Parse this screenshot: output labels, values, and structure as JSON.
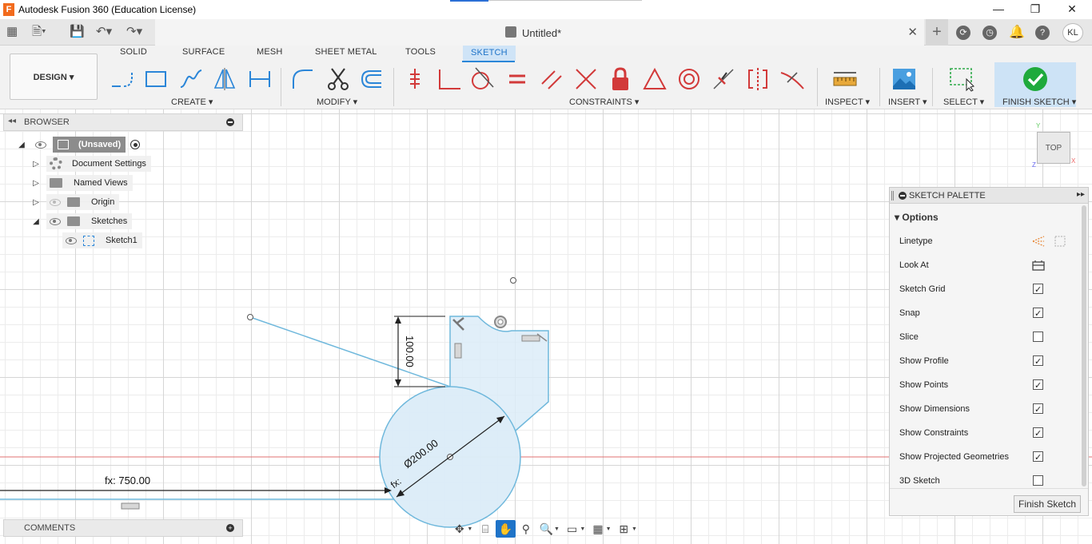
{
  "window": {
    "title": "Autodesk Fusion 360 (Education License)",
    "logo_letter": "F",
    "minimize": "—",
    "maximize": "❐",
    "close": "✕"
  },
  "appbar": {
    "doc_name": "Untitled*",
    "doc_close": "✕",
    "new_tab": "+",
    "user_initials": "KL"
  },
  "ribbon": {
    "tabs": [
      "SOLID",
      "SURFACE",
      "MESH",
      "SHEET METAL",
      "TOOLS",
      "SKETCH"
    ],
    "active_tab": "SKETCH",
    "workspace": "DESIGN ▾",
    "groups": {
      "create": "CREATE ▾",
      "modify": "MODIFY ▾",
      "constraints": "CONSTRAINTS ▾",
      "inspect": "INSPECT ▾",
      "insert": "INSERT ▾",
      "select": "SELECT ▾",
      "finish": "FINISH SKETCH ▾"
    },
    "accent_color": "#2b86d8",
    "finish_color": "#1faa3c",
    "constraint_red": "#d23a3a"
  },
  "browser": {
    "title": "BROWSER",
    "collapse": "◂◂",
    "root": "(Unsaved)",
    "items": [
      {
        "label": "Document Settings"
      },
      {
        "label": "Named Views"
      },
      {
        "label": "Origin"
      },
      {
        "label": "Sketches"
      },
      {
        "label": "Sketch1"
      }
    ]
  },
  "comments": {
    "title": "COMMENTS",
    "add": "+"
  },
  "viewcube": {
    "face": "TOP",
    "axis_x": "X",
    "axis_y": "Y",
    "axis_z": "Z"
  },
  "sketch": {
    "dim_vertical": "100.00",
    "dim_diameter": "Ø200.00",
    "dim_fx_prefix": "fx:",
    "dim_horizontal": "fx: 750.00",
    "line_color": "#6fb8dc",
    "fill_color": "#dcecf8",
    "axis_red": "#e07070"
  },
  "palette": {
    "title": "SKETCH PALETTE",
    "expand": "▸▸",
    "section": "▾ Options",
    "options": [
      {
        "label": "Linetype",
        "kind": "icon"
      },
      {
        "label": "Look At",
        "kind": "icon"
      },
      {
        "label": "Sketch Grid",
        "kind": "check",
        "checked": true
      },
      {
        "label": "Snap",
        "kind": "check",
        "checked": true
      },
      {
        "label": "Slice",
        "kind": "check",
        "checked": false
      },
      {
        "label": "Show Profile",
        "kind": "check",
        "checked": true
      },
      {
        "label": "Show Points",
        "kind": "check",
        "checked": true
      },
      {
        "label": "Show Dimensions",
        "kind": "check",
        "checked": true
      },
      {
        "label": "Show Constraints",
        "kind": "check",
        "checked": true
      },
      {
        "label": "Show Projected Geometries",
        "kind": "check",
        "checked": true
      },
      {
        "label": "3D Sketch",
        "kind": "check",
        "checked": false
      }
    ],
    "finish_button": "Finish Sketch"
  }
}
